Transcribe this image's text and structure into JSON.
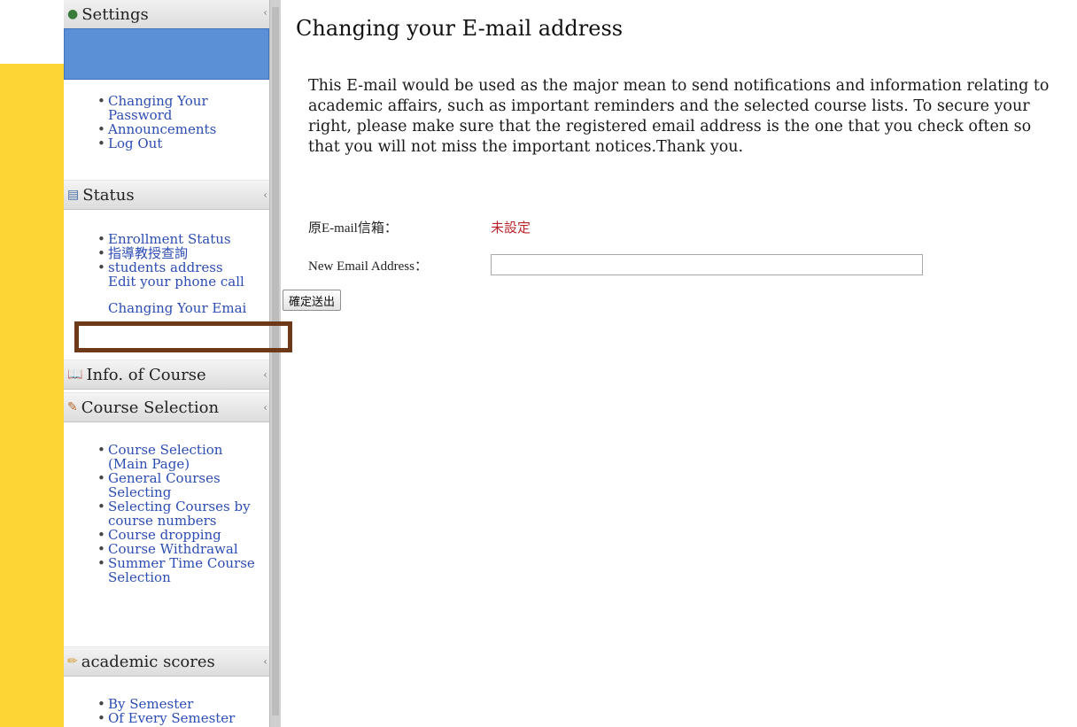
{
  "sidebar": {
    "settings": {
      "title": "Settings",
      "items": [
        "Changing Your Password",
        "Announcements",
        "Log Out"
      ]
    },
    "status": {
      "title": "Status",
      "items": [
        "Enrollment Status",
        "指導教授查詢",
        "students address",
        "Edit your phone call",
        "Changing Your Emai"
      ]
    },
    "info_course": {
      "title": "Info. of Course"
    },
    "course_selection": {
      "title": "Course Selection",
      "items": [
        "Course Selection (Main Page)",
        "General Courses Selecting",
        "Selecting Courses by course numbers",
        "Course dropping",
        "Course Withdrawal",
        "Summer Time Course Selection"
      ]
    },
    "academic_scores": {
      "title": "academic scores",
      "items": [
        "By Semester",
        "Of Every Semester"
      ]
    }
  },
  "main": {
    "title": "Changing your E-mail address",
    "notice": "This E-mail would be used as the major mean to send notifications and information relating to academic affairs, such as important reminders and the selected course lists. To secure your right, please make sure that the registered email address is the one that you check often so that you will not miss the important notices.Thank you.",
    "original_email_label": "原E-mail信箱：",
    "original_email_value": "未設定",
    "new_email_label": "New Email Address：",
    "new_email_value": "",
    "submit_label": "確定送出"
  },
  "colors": {
    "accent_stripe": "#fdd535",
    "blue_bar": "#5b8fd6",
    "link": "#2c4db3",
    "highlight_box": "#6e3918",
    "not_set": "#b8232a"
  },
  "icons": {
    "settings": "person-icon",
    "status": "id-card-icon",
    "info_course": "book-icon",
    "course_selection": "clipboard-icon",
    "academic_scores": "pencil-icon"
  }
}
